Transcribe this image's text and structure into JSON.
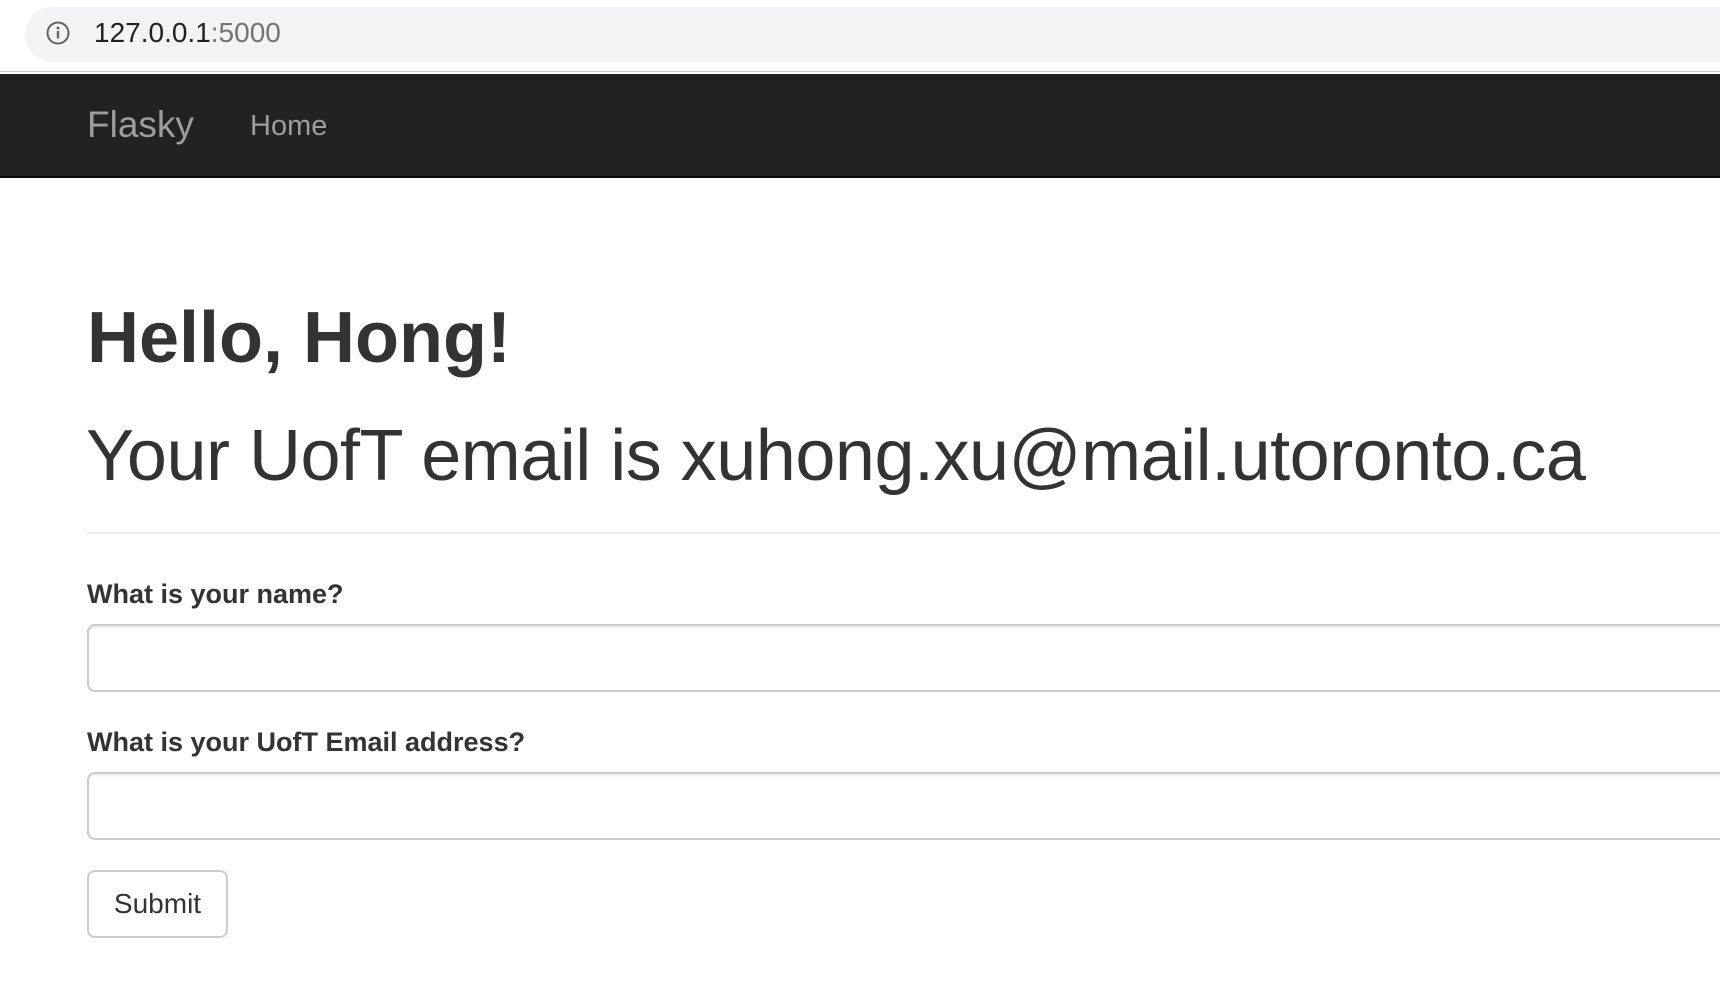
{
  "browser": {
    "url_host": "127.0.0.1",
    "url_port": ":5000",
    "icons": {
      "site_info": "info-circle-icon"
    }
  },
  "navbar": {
    "brand": "Flasky",
    "home_link": "Home",
    "background_color": "#222222",
    "link_color": "#9d9d9d"
  },
  "main": {
    "greeting": "Hello, Hong!",
    "email_line": "Your UofT email is xuhong.xu@mail.utoronto.ca"
  },
  "form": {
    "name_label": "What is your name?",
    "name_value": "",
    "email_label": "What is your UofT Email address?",
    "email_value": "",
    "submit_label": "Submit"
  }
}
